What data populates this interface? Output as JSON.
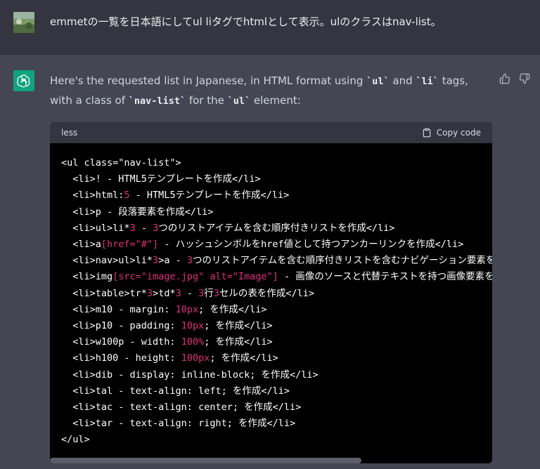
{
  "user": {
    "message": "emmetの一覧を日本語にしてul liタグでhtmlとして表示。ulのクラスはnav-list。"
  },
  "assistant": {
    "intro_parts": [
      {
        "t": "Here's the requested list in Japanese, in HTML format using "
      },
      {
        "c": "`ul`"
      },
      {
        "t": " and "
      },
      {
        "c": "`li`"
      },
      {
        "t": " tags, with a class of "
      },
      {
        "c": "`nav-list`"
      },
      {
        "t": " for the "
      },
      {
        "c": "`ul`"
      },
      {
        "t": " element:"
      }
    ],
    "code_block": {
      "language": "less",
      "copy_label": "Copy code",
      "lines": [
        [
          {
            "t": "<ul class=\"nav-list\">"
          }
        ],
        [
          {
            "t": "  <li>! - HTML5テンプレートを作成</li>"
          }
        ],
        [
          {
            "t": "  <li>html:"
          },
          {
            "t": "5",
            "c": "num"
          },
          {
            "t": " - HTML5テンプレートを作成</li>"
          }
        ],
        [
          {
            "t": "  <li>p - 段落要素を作成</li>"
          }
        ],
        [
          {
            "t": "  <li>ul>li*"
          },
          {
            "t": "3",
            "c": "num"
          },
          {
            "t": " - "
          },
          {
            "t": "3",
            "c": "num"
          },
          {
            "t": "つのリストアイテムを含む順序付きリストを作成</li>"
          }
        ],
        [
          {
            "t": "  <li>a"
          },
          {
            "t": "[href=\"#\"]",
            "c": "num"
          },
          {
            "t": " - ハッシュシンボルをhref値として持つアンカーリンクを作成</li>"
          }
        ],
        [
          {
            "t": "  <li>nav>ul>li*"
          },
          {
            "t": "3",
            "c": "num"
          },
          {
            "t": ">a - "
          },
          {
            "t": "3",
            "c": "num"
          },
          {
            "t": "つのリストアイテムを含む順序付きリストを含むナビゲーション要素を作成。各"
          }
        ],
        [
          {
            "t": "  <li>img"
          },
          {
            "t": "[src=\"image.jpg\" alt=\"Image\"]",
            "c": "num"
          },
          {
            "t": " - 画像のソースと代替テキストを持つ画像要素を作成"
          }
        ],
        [
          {
            "t": "  <li>table>tr*"
          },
          {
            "t": "3",
            "c": "num"
          },
          {
            "t": ">td*"
          },
          {
            "t": "3",
            "c": "num"
          },
          {
            "t": " - "
          },
          {
            "t": "3",
            "c": "num"
          },
          {
            "t": "行"
          },
          {
            "t": "3",
            "c": "num"
          },
          {
            "t": "セルの表を作成</li>"
          }
        ],
        [
          {
            "t": "  <li>m10 - margin: "
          },
          {
            "t": "10px",
            "c": "num"
          },
          {
            "t": "; を作成</li>"
          }
        ],
        [
          {
            "t": "  <li>p10 - padding: "
          },
          {
            "t": "10px",
            "c": "num"
          },
          {
            "t": "; を作成</li>"
          }
        ],
        [
          {
            "t": "  <li>w100p - width: "
          },
          {
            "t": "100%",
            "c": "num"
          },
          {
            "t": "; を作成</li>"
          }
        ],
        [
          {
            "t": "  <li>h100 - height: "
          },
          {
            "t": "100px",
            "c": "num"
          },
          {
            "t": "; を作成</li>"
          }
        ],
        [
          {
            "t": "  <li>dib - display: inline-block; を作成</li>"
          }
        ],
        [
          {
            "t": "  <li>tal - text-align: left; を作成</li>"
          }
        ],
        [
          {
            "t": "  <li>tac - text-align: center; を作成</li>"
          }
        ],
        [
          {
            "t": "  <li>tar - text-align: right; を作成</li>"
          }
        ],
        [
          {
            "t": "</ul>"
          }
        ]
      ]
    }
  },
  "icons": {
    "thumbs_up": "thumbs-up-icon",
    "thumbs_down": "thumbs-down-icon",
    "copy": "clipboard-icon",
    "bot_logo": "openai-logo-icon"
  },
  "colors": {
    "user_bg": "#343541",
    "assistant_bg": "#444654",
    "code_bg": "#000000",
    "code_header_bg": "#343541",
    "brand_green": "#10a37f",
    "number_token": "#df3079"
  }
}
